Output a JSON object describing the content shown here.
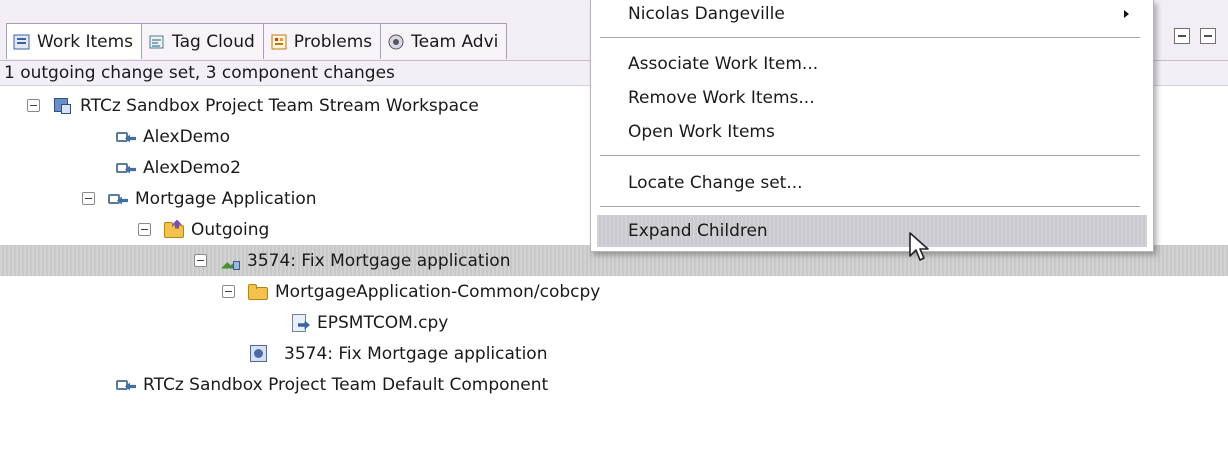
{
  "tabs": [
    {
      "label": "Work Items",
      "icon": "work-items-icon"
    },
    {
      "label": "Tag Cloud",
      "icon": "tag-cloud-icon"
    },
    {
      "label": "Problems",
      "icon": "problems-icon"
    },
    {
      "label": "Team Advi",
      "icon": "team-advisor-icon"
    }
  ],
  "status": "1 outgoing change set, 3 component changes",
  "tree": [
    {
      "label": "RTCz Sandbox Project Team Stream Workspace",
      "icon": "workspace-icon"
    },
    {
      "label": "AlexDemo",
      "icon": "component-icon"
    },
    {
      "label": "AlexDemo2",
      "icon": "component-icon"
    },
    {
      "label": "Mortgage Application",
      "icon": "component-icon"
    },
    {
      "label": "Outgoing",
      "icon": "outgoing-folder-icon"
    },
    {
      "label": "3574: Fix Mortgage application",
      "icon": "change-set-icon"
    },
    {
      "label": "MortgageApplication-Common/cobcpy",
      "icon": "folder-icon"
    },
    {
      "label": "EPSMTCOM.cpy",
      "icon": "file-icon"
    },
    {
      "label": "3574: Fix Mortgage application",
      "icon": "work-item-icon"
    },
    {
      "label": "RTCz Sandbox Project Team Default Component",
      "icon": "component-icon"
    }
  ],
  "menu": {
    "top_item": "Nicolas Dangeville",
    "items": [
      "Associate Work Item...",
      "Remove Work Items...",
      "Open Work Items",
      "Locate Change set...",
      "Expand Children"
    ]
  }
}
